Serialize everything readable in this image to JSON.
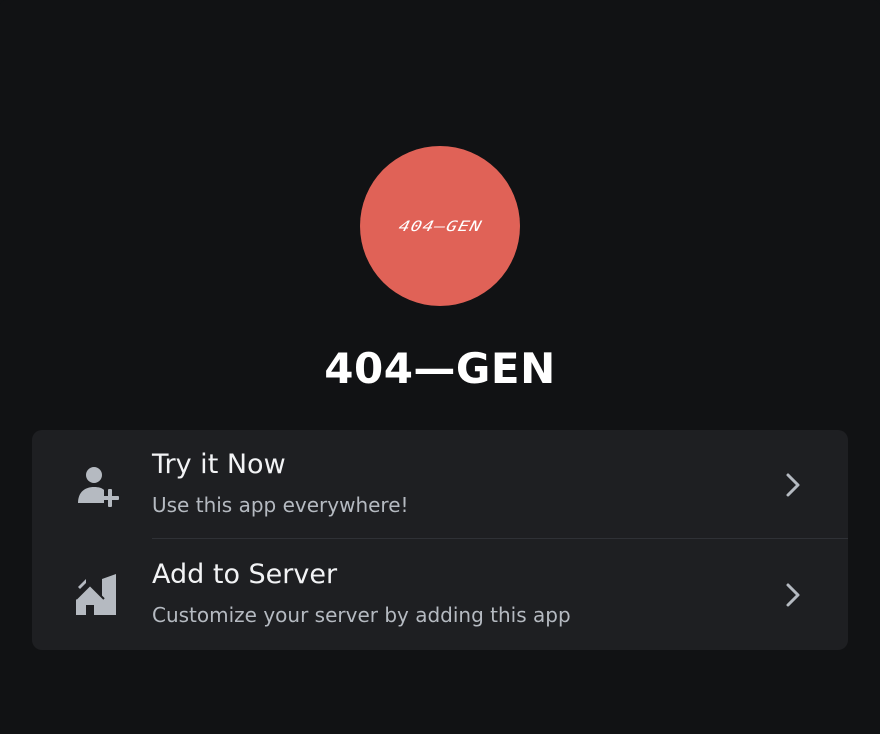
{
  "app": {
    "avatar_logo": "404—GEN",
    "name": "404—GEN",
    "avatar_color": "#e06257"
  },
  "options": [
    {
      "title": "Try it Now",
      "subtitle": "Use this app everywhere!",
      "icon": "user-add-icon"
    },
    {
      "title": "Add to Server",
      "subtitle": "Customize your server by adding this app",
      "icon": "server-add-icon"
    }
  ],
  "colors": {
    "background": "#111214",
    "card": "#1e1f22",
    "text_primary": "#f2f3f5",
    "text_secondary": "#b5bac1",
    "icon": "#b5bac1"
  }
}
